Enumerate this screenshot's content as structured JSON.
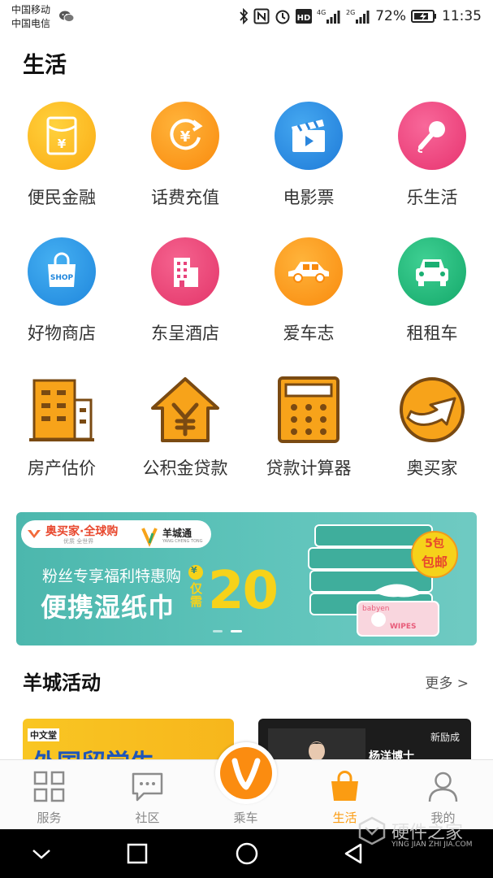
{
  "status_bar": {
    "carrier_1": "中国移动",
    "carrier_2": "中国电信",
    "battery": "72%",
    "time": "11:35",
    "signal_1": "4G",
    "signal_2": "2G"
  },
  "section_life": {
    "title": "生活"
  },
  "services": [
    {
      "label": "便民金融",
      "icon": "red-envelope-yen-icon",
      "color": "#fbb21b"
    },
    {
      "label": "话费充值",
      "icon": "yen-refresh-icon",
      "color": "#fb9c12"
    },
    {
      "label": "电影票",
      "icon": "clapperboard-icon",
      "color": "#2e8fe3"
    },
    {
      "label": "乐生活",
      "icon": "microphone-icon",
      "color": "#f04a84"
    },
    {
      "label": "好物商店",
      "icon": "shopping-bag-icon",
      "color": "#2d9ae6",
      "icon_text": "SHOP"
    },
    {
      "label": "东呈酒店",
      "icon": "hotel-building-icon",
      "color": "#f0457c"
    },
    {
      "label": "爱车志",
      "icon": "car-side-icon",
      "color": "#fb9c12"
    },
    {
      "label": "租租车",
      "icon": "car-front-icon",
      "color": "#23b77c"
    },
    {
      "label": "房产估价",
      "icon": "buildings-icon",
      "color": "#f7a31a"
    },
    {
      "label": "公积金贷款",
      "icon": "house-yen-icon",
      "color": "#f7a31a"
    },
    {
      "label": "贷款计算器",
      "icon": "calculator-icon",
      "color": "#f7a31a"
    },
    {
      "label": "奥买家",
      "icon": "arrow-circle-logo-icon",
      "color": "#f7a31a"
    }
  ],
  "banner": {
    "brand_1": "奥买家·全球购",
    "brand_1_sub": "优质 全世界",
    "brand_2": "羊城通",
    "brand_2_sub": "YANG CHENG TONG",
    "headline_small": "粉丝专享福利特惠购",
    "headline_big": "便携湿纸巾",
    "price_yen": "¥",
    "price_prefix": "仅需",
    "price": "20",
    "badge_line1": "5包",
    "badge_line2": "包邮",
    "product_brand": "babyen",
    "product_word": "WIPES",
    "accent": "#f6d21a"
  },
  "section_activity": {
    "title": "羊城活动",
    "more": "更多 >"
  },
  "cards": [
    {
      "logo_text": "中文堂",
      "headline": "外国留学生"
    },
    {
      "logo_text": "新励成",
      "name": "杨洋博士"
    }
  ],
  "tabs": [
    {
      "label": "服务",
      "icon": "grid-icon",
      "active": false
    },
    {
      "label": "社区",
      "icon": "chat-icon",
      "active": false
    },
    {
      "label": "乘车",
      "icon": "v-logo-icon",
      "active": false
    },
    {
      "label": "生活",
      "icon": "bag-icon",
      "active": true
    },
    {
      "label": "我的",
      "icon": "person-icon",
      "active": false
    }
  ],
  "watermark": {
    "title": "硬件之家",
    "subtitle": "YING JIAN ZHI JIA.COM"
  },
  "colors": {
    "accent": "#fb9c12",
    "tab_inactive": "#888888",
    "tab_active": "#fb9c12"
  }
}
